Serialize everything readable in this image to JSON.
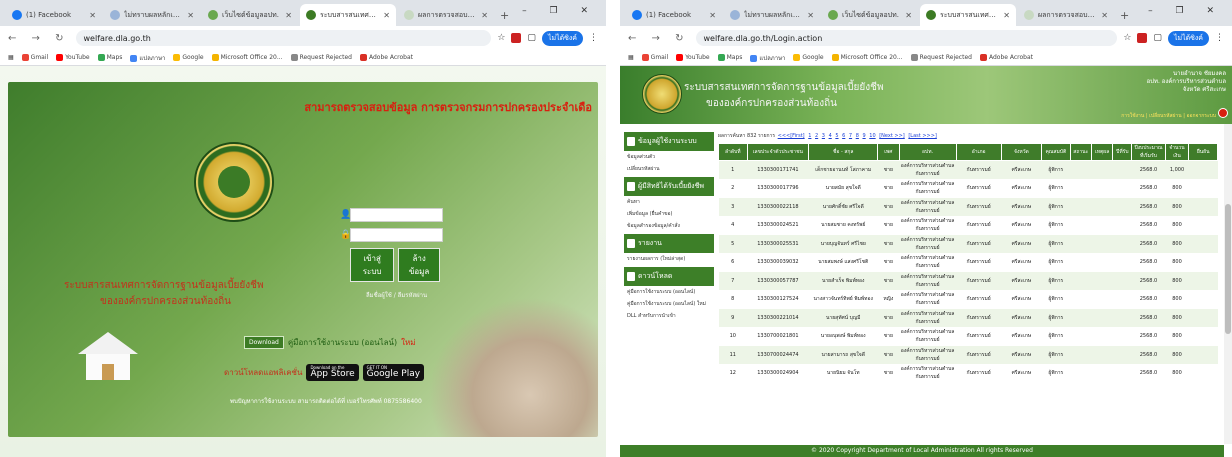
{
  "left": {
    "tabs": [
      {
        "label": "(1) Facebook",
        "active": false
      },
      {
        "label": "ไม่ทราบผลหลักเกณฑ์การศึกษา",
        "active": false
      },
      {
        "label": "เว็บไซต์ข้อมูลอปท.",
        "active": false
      },
      {
        "label": "ระบบสารสนเทศการจัดการฐานข้อมูล",
        "active": true
      },
      {
        "label": "ผลการตรวจสอบข้อมูล",
        "active": false
      }
    ],
    "url": "welfare.dla.go.th",
    "profile": "ไม่ได้ซิงค์",
    "bookmarks": [
      "Gmail",
      "YouTube",
      "Maps",
      "แปลภาษา",
      "Google",
      "Microsoft Office 20...",
      "Request Rejected",
      "Adobe Acrobat"
    ],
    "page": {
      "red_title": "สามารถตรวจสอบข้อมูล การตรวจกรมการปกครองประจำเดือ",
      "system_name_1": "ระบบสารสนเทศการจัดการฐานข้อมูลเบี้ยยังชีพ",
      "system_name_2": "ขององค์กรปกครองส่วนท้องถิ่น",
      "login_button": "เข้าสู่ระบบ",
      "clear_button": "ล้างข้อมูล",
      "forgot_link": "ลืมชื่อผู้ใช้ / ลืมรหัสผ่าน",
      "download_badge": "Download",
      "manual_text": "คู่มือการใช้งานระบบ (ออนไลน์)",
      "manual_new": "ใหม่",
      "app_label": "ดาวน์โหลดแอพลิเคชั่น",
      "app_store_small": "Download on the",
      "app_store": "App Store",
      "google_play_small": "GET IT ON",
      "google_play": "Google Play",
      "contact": "พบปัญหาการใช้งานระบบ สามารถติดต่อได้ที่ เบอร์โทรศัพท์ 0875586400"
    }
  },
  "right": {
    "tabs": [
      {
        "label": "(1) Facebook",
        "active": false
      },
      {
        "label": "ไม่ทราบผลหลักเกณฑ์การศึกษา",
        "active": false
      },
      {
        "label": "เว็บไซต์ข้อมูลอปท.",
        "active": false
      },
      {
        "label": "ระบบสารสนเทศการจัดการฐานข้อมูล",
        "active": true
      },
      {
        "label": "ผลการตรวจสอบข้อมูล",
        "active": false
      }
    ],
    "url": "welfare.dla.go.th/Login.action",
    "profile": "ไม่ได้ซิงค์",
    "bookmarks": [
      "Gmail",
      "YouTube",
      "Maps",
      "แปลภาษา",
      "Google",
      "Microsoft Office 20...",
      "Request Rejected",
      "Adobe Acrobat"
    ],
    "banner": {
      "title_1": "ระบบสารสนเทศการจัดการฐานข้อมูลเบี้ยยังชีพ",
      "title_2": "ขององค์กรปกครองส่วนท้องถิ่น",
      "user_line_1": "นายอำนาจ ชัยมงคล",
      "user_line_2": "อปท. องค์การบริหารส่วนตำบล",
      "user_line_3": "จังหวัด ศรีสะเกษ",
      "links": "การใช้งาน | เปลี่ยนรหัสผ่าน | ออกจากระบบ"
    },
    "sidebar": [
      {
        "heading": "ข้อมูลผู้ใช้งานระบบ",
        "items": [
          "ข้อมูลส่วนตัว",
          "เปลี่ยนรหัสผ่าน"
        ]
      },
      {
        "heading": "ผู้มีสิทธิได้รับเบี้ยยังชีพ",
        "items": [
          "ค้นหา",
          "เพิ่มข้อมูล (ยื่นคำขอ)",
          "ข้อมูลสำรองข้อมูล/คำสั่ง"
        ]
      },
      {
        "heading": "รายงาน",
        "items": [
          "รายงานผลการ (ใหม่ล่าสุด)"
        ]
      },
      {
        "heading": "ดาวน์โหลด",
        "items": [
          "คู่มือการใช้งานระบบ (ออนไลน์)",
          "คู่มือการใช้งานระบบ (ออนไลน์) ใหม่",
          "DLL สำหรับการนำเข้า"
        ]
      }
    ],
    "pager": {
      "summary": "ผลการค้นหา 832 รายการ",
      "first": "<<<[First]",
      "pages": [
        "1",
        "2",
        "3",
        "4",
        "5",
        "6",
        "7",
        "8",
        "9",
        "10"
      ],
      "next": "[Next >>]",
      "last": "[Last >>>]"
    },
    "table": {
      "headers": [
        "ลำดับที่",
        "เลขประจำตัวประชาชน",
        "ชื่อ - สกุล",
        "เพศ",
        "อปท.",
        "อำเภอ",
        "จังหวัด",
        "คุณสมบัติ",
        "สถานะ",
        "เหตุผล",
        "ปีที่รับ",
        "ปีงบประมาณที่เริ่มรับ",
        "จำนวนเงิน",
        "ยืนยัน"
      ],
      "rows": [
        [
          "1",
          "1330300171741",
          "เด็กชายอานนท์ โสภาคาม",
          "ชาย",
          "องค์การบริหารส่วนตำบลกันทรารมย์",
          "กันทรารมย์",
          "ศรีสะเกษ",
          "ผู้พิการ",
          "",
          "",
          "",
          "2568.0",
          "1,000",
          ""
        ],
        [
          "2",
          "1330300017796",
          "นายสมัย สุขใจดี",
          "ชาย",
          "องค์การบริหารส่วนตำบลกันทรารมย์",
          "กันทรารมย์",
          "ศรีสะเกษ",
          "ผู้พิการ",
          "",
          "",
          "",
          "2568.0",
          "800",
          ""
        ],
        [
          "3",
          "1330300022118",
          "นายศักดิ์ชัย ศรีใจดี",
          "ชาย",
          "องค์การบริหารส่วนตำบลกันทรารมย์",
          "กันทรารมย์",
          "ศรีสะเกษ",
          "ผู้พิการ",
          "",
          "",
          "",
          "2568.0",
          "800",
          ""
        ],
        [
          "4",
          "1330300024521",
          "นายสมชาย คงทรัพย์",
          "ชาย",
          "องค์การบริหารส่วนตำบลกันทรารมย์",
          "กันทรารมย์",
          "ศรีสะเกษ",
          "ผู้พิการ",
          "",
          "",
          "",
          "2568.0",
          "800",
          ""
        ],
        [
          "5",
          "1330300025531",
          "นายบุญจันทร์ ศรีไชย",
          "ชาย",
          "องค์การบริหารส่วนตำบลกันทรารมย์",
          "กันทรารมย์",
          "ศรีสะเกษ",
          "ผู้พิการ",
          "",
          "",
          "",
          "2568.0",
          "800",
          ""
        ],
        [
          "6",
          "1330300039032",
          "นายสมพงษ์ แสงศรีโชติ",
          "ชาย",
          "องค์การบริหารส่วนตำบลกันทรารมย์",
          "กันทรารมย์",
          "ศรีสะเกษ",
          "ผู้พิการ",
          "",
          "",
          "",
          "2568.0",
          "800",
          ""
        ],
        [
          "7",
          "1330300057787",
          "นายสำเร็จ พิมพ์ทอง",
          "ชาย",
          "องค์การบริหารส่วนตำบลกันทรารมย์",
          "กันทรารมย์",
          "ศรีสะเกษ",
          "ผู้พิการ",
          "",
          "",
          "",
          "2568.0",
          "800",
          ""
        ],
        [
          "8",
          "1330300127524",
          "นางสาวจันทร์ทิพย์ พิมพ์ทอง",
          "หญิง",
          "องค์การบริหารส่วนตำบลกันทรารมย์",
          "กันทรารมย์",
          "ศรีสะเกษ",
          "ผู้พิการ",
          "",
          "",
          "",
          "2568.0",
          "800",
          ""
        ],
        [
          "9",
          "1330300221014",
          "นายสุทัศน์ บุญมี",
          "ชาย",
          "องค์การบริหารส่วนตำบลกันทรารมย์",
          "กันทรารมย์",
          "ศรีสะเกษ",
          "ผู้พิการ",
          "",
          "",
          "",
          "2568.0",
          "800",
          ""
        ],
        [
          "10",
          "1330700021801",
          "นายอนุพงษ์ พิมพ์ทอง",
          "ชาย",
          "องค์การบริหารส่วนตำบลกันทรารมย์",
          "กันทรารมย์",
          "ศรีสะเกษ",
          "ผู้พิการ",
          "",
          "",
          "",
          "2568.0",
          "800",
          ""
        ],
        [
          "11",
          "1330700024474",
          "นายสามารถ สุขใจดี",
          "ชาย",
          "องค์การบริหารส่วนตำบลกันทรารมย์",
          "กันทรารมย์",
          "ศรีสะเกษ",
          "ผู้พิการ",
          "",
          "",
          "",
          "2568.0",
          "800",
          ""
        ],
        [
          "12",
          "1330300024904",
          "นายนิยม จันโท",
          "ชาย",
          "องค์การบริหารส่วนตำบลกันทรารมย์",
          "กันทรารมย์",
          "ศรีสะเกษ",
          "ผู้พิการ",
          "",
          "",
          "",
          "2568.0",
          "800",
          ""
        ]
      ]
    },
    "footer": "© 2020 Copyright Department of Local Administration All rights Reserved",
    "colors": {
      "header_green": "#3f7c2a",
      "row_alt": "#edf5e7",
      "accent_red": "#d8200f"
    }
  }
}
